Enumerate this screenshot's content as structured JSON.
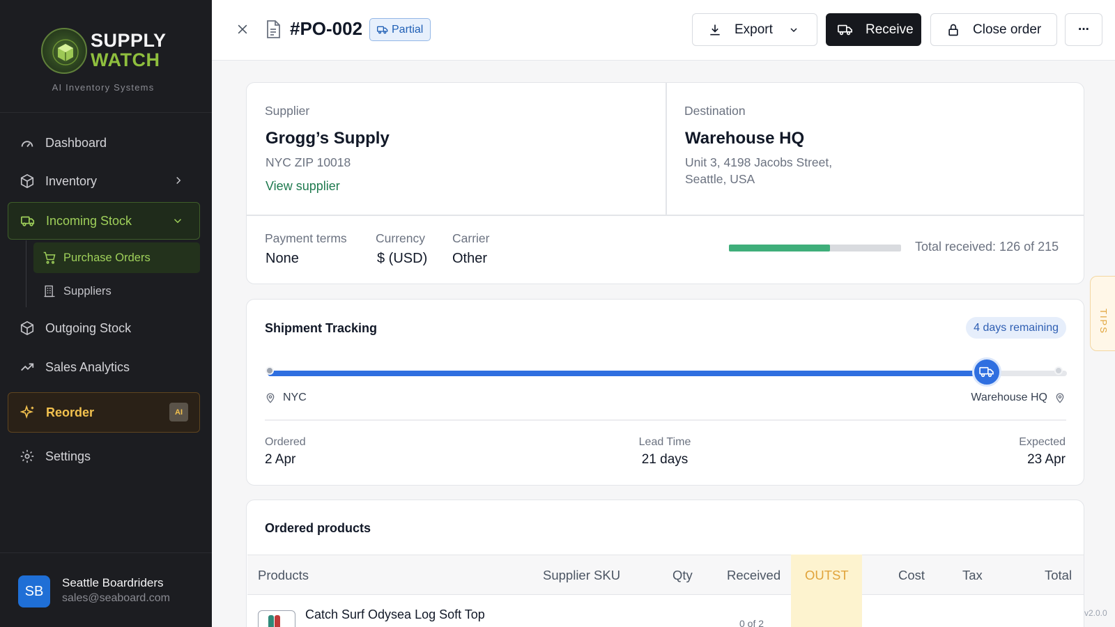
{
  "brand": {
    "name_line1": "SUPPLY",
    "name_line2": "WATCH",
    "tagline": "AI Inventory Systems"
  },
  "sidebar": {
    "items": [
      {
        "label": "Dashboard",
        "icon": "gauge-icon"
      },
      {
        "label": "Inventory",
        "icon": "box-icon"
      },
      {
        "label": "Incoming Stock",
        "icon": "truck-icon",
        "expanded": true,
        "children": [
          {
            "label": "Purchase Orders",
            "icon": "cart-icon",
            "active": true
          },
          {
            "label": "Suppliers",
            "icon": "building-icon"
          }
        ]
      },
      {
        "label": "Outgoing Stock",
        "icon": "box-icon"
      },
      {
        "label": "Sales Analytics",
        "icon": "trend-icon"
      },
      {
        "label": "Reorder",
        "icon": "sparkle-icon",
        "badge": "AI"
      },
      {
        "label": "Settings",
        "icon": "gear-icon"
      }
    ],
    "user": {
      "initials": "SB",
      "name": "Seattle Boardriders",
      "email": "sales@seaboard.com"
    }
  },
  "header": {
    "po_number": "#PO-002",
    "status": "Partial",
    "export_label": "Export",
    "receive_label": "Receive",
    "close_label": "Close order",
    "more_label": "···"
  },
  "supplier": {
    "label": "Supplier",
    "name": "Grogg’s Supply",
    "address": "NYC ZIP 10018",
    "link": "View supplier"
  },
  "destination": {
    "label": "Destination",
    "name": "Warehouse HQ",
    "address_line1": "Unit 3, 4198 Jacobs Street,",
    "address_line2": "Seattle, USA"
  },
  "terms": {
    "payment_label": "Payment terms",
    "payment_value": "None",
    "currency_label": "Currency",
    "currency_value": "$ (USD)",
    "carrier_label": "Carrier",
    "carrier_value": "Other",
    "received_text": "Total received: 126 of 215",
    "received_fraction": 0.586
  },
  "tracking": {
    "title": "Shipment Tracking",
    "remaining": "4 days remaining",
    "progress_fraction": 0.9,
    "origin": "NYC",
    "destination": "Warehouse HQ",
    "ordered_label": "Ordered",
    "ordered_value": "2 Apr",
    "lead_label": "Lead Time",
    "lead_value": "21 days",
    "expected_label": "Expected",
    "expected_value": "23 Apr"
  },
  "products": {
    "title": "Ordered products",
    "columns": [
      "Products",
      "Supplier SKU",
      "Qty",
      "Received",
      "OUTST",
      "Cost",
      "Tax",
      "Total"
    ],
    "rows": [
      {
        "name": "Catch Surf Odysea Log Soft Top",
        "received": "0 of 2"
      }
    ]
  },
  "tips_label": "TIPS",
  "version": "v2.0.0",
  "colors": {
    "accent_green": "#9fd05a",
    "progress_green": "#3fae7a",
    "track_blue": "#2f6fe0",
    "reorder_gold": "#f2c14e"
  }
}
